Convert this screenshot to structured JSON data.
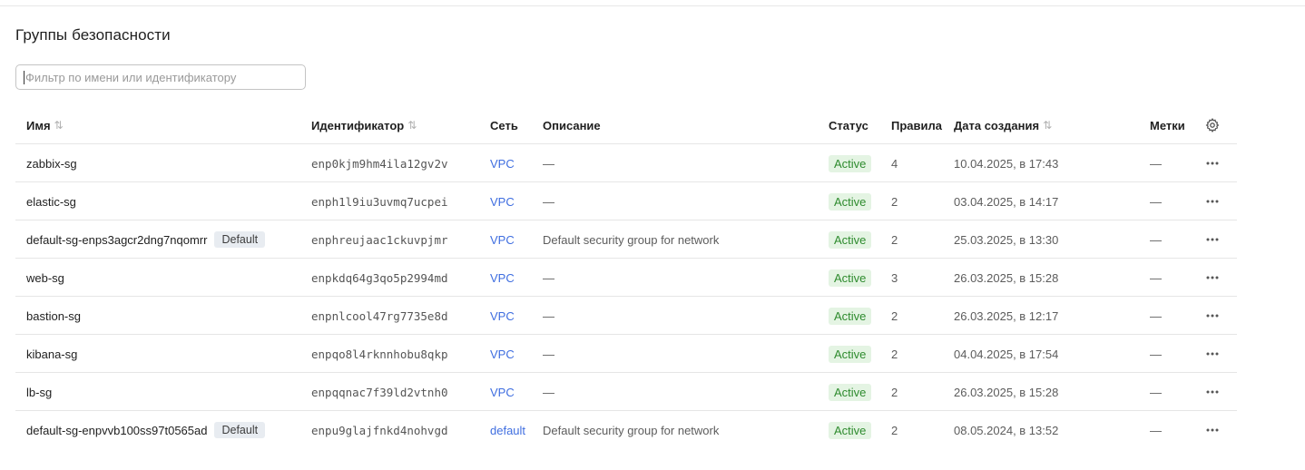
{
  "page": {
    "title": "Группы безопасности"
  },
  "filter": {
    "placeholder": "Фильтр по имени или идентификатору",
    "value": ""
  },
  "table": {
    "columns": {
      "name": "Имя",
      "id": "Идентификатор",
      "network": "Сеть",
      "description": "Описание",
      "status": "Статус",
      "rules": "Правила",
      "created": "Дата создания",
      "labels": "Метки"
    },
    "sort_icon": "⇅",
    "settings_icon": "gear-icon",
    "row_menu_icon": "more-horizontal-icon",
    "rows": [
      {
        "name": "zabbix-sg",
        "badge": "",
        "id": "enp0kjm9hm4ila12gv2v",
        "network": "VPC",
        "description": "—",
        "status": "Active",
        "rules": "4",
        "created": "10.04.2025, в 17:43",
        "labels": "—"
      },
      {
        "name": "elastic-sg",
        "badge": "",
        "id": "enph1l9iu3uvmq7ucpei",
        "network": "VPC",
        "description": "—",
        "status": "Active",
        "rules": "2",
        "created": "03.04.2025, в 14:17",
        "labels": "—"
      },
      {
        "name": "default-sg-enps3agcr2dng7nqomrr",
        "badge": "Default",
        "id": "enphreujaac1ckuvpjmr",
        "network": "VPC",
        "description": "Default security group for network",
        "status": "Active",
        "rules": "2",
        "created": "25.03.2025, в 13:30",
        "labels": "—"
      },
      {
        "name": "web-sg",
        "badge": "",
        "id": "enpkdq64g3qo5p2994md",
        "network": "VPC",
        "description": "—",
        "status": "Active",
        "rules": "3",
        "created": "26.03.2025, в 15:28",
        "labels": "—"
      },
      {
        "name": "bastion-sg",
        "badge": "",
        "id": "enpnlcool47rg7735e8d",
        "network": "VPC",
        "description": "—",
        "status": "Active",
        "rules": "2",
        "created": "26.03.2025, в 12:17",
        "labels": "—"
      },
      {
        "name": "kibana-sg",
        "badge": "",
        "id": "enpqo8l4rknnhobu8qkp",
        "network": "VPC",
        "description": "—",
        "status": "Active",
        "rules": "2",
        "created": "04.04.2025, в 17:54",
        "labels": "—"
      },
      {
        "name": "lb-sg",
        "badge": "",
        "id": "enpqqnac7f39ld2vtnh0",
        "network": "VPC",
        "description": "—",
        "status": "Active",
        "rules": "2",
        "created": "26.03.2025, в 15:28",
        "labels": "—"
      },
      {
        "name": "default-sg-enpvvb100ss97t0565ad",
        "badge": "Default",
        "id": "enpu9glajfnkd4nohvgd",
        "network": "default",
        "description": "Default security group for network",
        "status": "Active",
        "rules": "2",
        "created": "08.05.2024, в 13:52",
        "labels": "—"
      }
    ]
  },
  "colors": {
    "link": "#3f6ee0",
    "status_active_bg": "#e4f4e3",
    "status_active_text": "#2e8b2e",
    "badge_default_bg": "#e8ecf1"
  }
}
